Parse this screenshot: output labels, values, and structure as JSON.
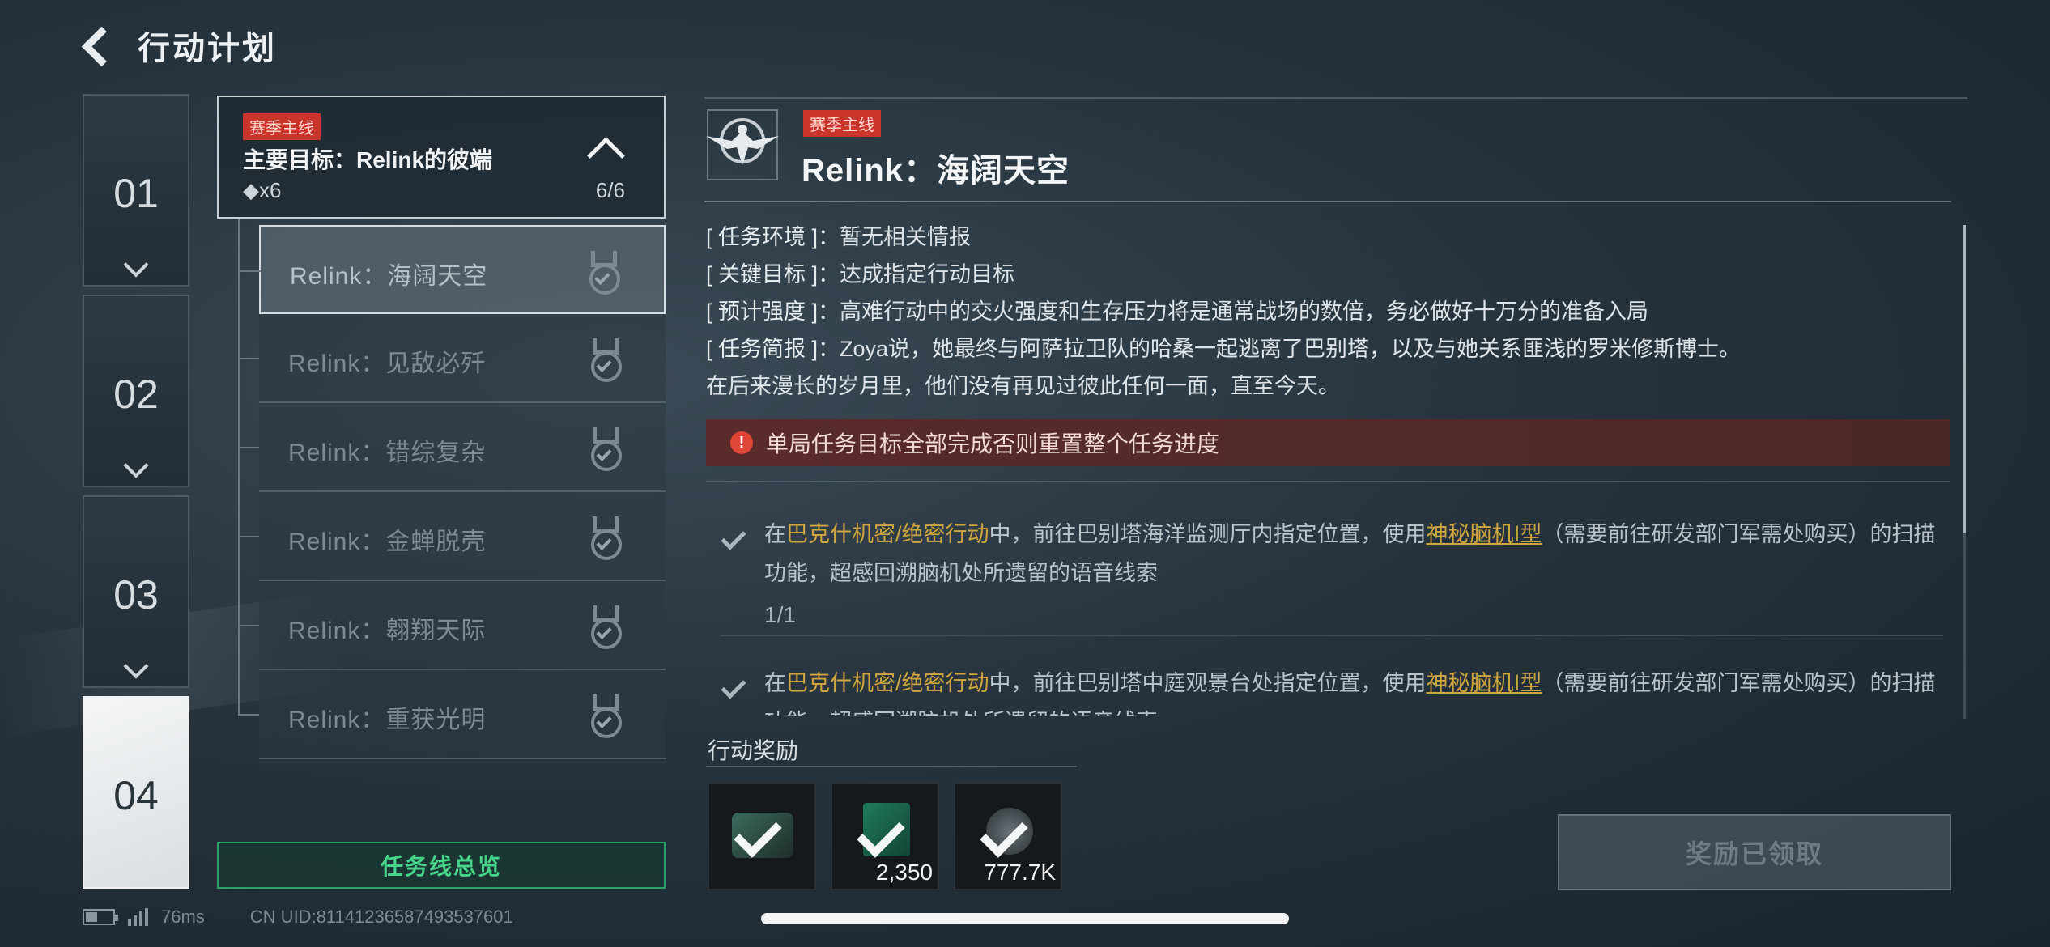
{
  "header": {
    "title": "行动计划"
  },
  "chapters": [
    "01",
    "02",
    "03",
    "04"
  ],
  "main_goal": {
    "tag": "赛季主线",
    "title": "主要目标：Relink的彼端",
    "count": "◆x6",
    "progress": "6/6"
  },
  "sub_missions": [
    "Relink：海阔天空",
    "Relink：见敌必歼",
    "Relink：错综复杂",
    "Relink：金蝉脱壳",
    "Relink：翱翔天际",
    "Relink：重获光明"
  ],
  "overview_button": "任务线总览",
  "status": {
    "ping": "76ms",
    "uid": "CN UID:81141236587493537601"
  },
  "detail": {
    "tag": "赛季主线",
    "title": "Relink：海阔天空",
    "info": [
      {
        "key": "[ 任务环境 ]",
        "value": "：暂无相关情报"
      },
      {
        "key": "[ 关键目标 ]",
        "value": "：达成指定行动目标"
      },
      {
        "key": "[ 预计强度 ]",
        "value": "：高难行动中的交火强度和生存压力将是通常战场的数倍，务必做好十万分的准备入局"
      },
      {
        "key": "[ 任务简报 ]",
        "value": "：Zoya说，她最终与阿萨拉卫队的哈桑一起逃离了巴别塔，以及与她关系匪浅的罗米修斯博士。"
      }
    ],
    "info_extra": "在后来漫长的岁月里，他们没有再见过彼此任何一面，直至今天。",
    "warning": "单局任务目标全部完成否则重置整个任务进度",
    "objectives": [
      {
        "pre": "在",
        "mode": "巴克什机密/绝密行动",
        "mid": "中，前往巴别塔海洋监测厅内指定位置，使用",
        "item": "神秘脑机Ⅰ型",
        "post": "（需要前往研发部门军需处购买）的扫描功能，超感回溯脑机处所遗留的语音线索",
        "progress": "1/1"
      },
      {
        "pre": "在",
        "mode": "巴克什机密/绝密行动",
        "mid": "中，前往巴别塔中庭观景台处指定位置，使用",
        "item": "神秘脑机Ⅰ型",
        "post": "（需要前往研发部门军需处购买）的扫描功能，超感回溯脑机处所遗留的语音线索"
      }
    ]
  },
  "rewards": {
    "title": "行动奖励",
    "items": [
      {
        "icon": "supply-crate-icon",
        "qty": ""
      },
      {
        "icon": "card-icon",
        "qty": "2,350"
      },
      {
        "icon": "coin-icon",
        "qty": "777.7K"
      }
    ],
    "claimed_label": "奖励已领取"
  }
}
